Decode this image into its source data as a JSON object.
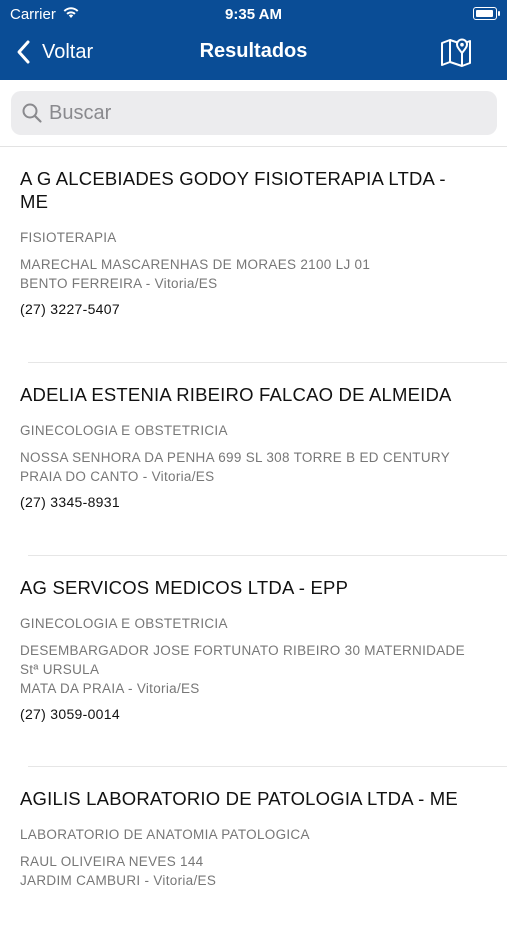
{
  "status_bar": {
    "carrier": "Carrier",
    "time": "9:35 AM"
  },
  "nav": {
    "back_label": "Voltar",
    "title": "Resultados",
    "map_icon": "map-pin-icon"
  },
  "search": {
    "placeholder": "Buscar",
    "value": ""
  },
  "colors": {
    "nav_background": "#0a4d96",
    "search_background": "#ececee"
  },
  "results": [
    {
      "name": "A G ALCEBIADES GODOY FISIOTERAPIA LTDA - ME",
      "category": "FISIOTERAPIA",
      "street": "MARECHAL MASCARENHAS DE MORAES 2100 LJ 01",
      "locality": "BENTO FERREIRA - Vitoria/ES",
      "phone": "(27) 3227-5407"
    },
    {
      "name": "ADELIA ESTENIA RIBEIRO FALCAO DE ALMEIDA",
      "category": "GINECOLOGIA E OBSTETRICIA",
      "street": "NOSSA SENHORA DA PENHA 699 SL 308 TORRE B ED CENTURY",
      "locality": "PRAIA DO CANTO - Vitoria/ES",
      "phone": "(27) 3345-8931"
    },
    {
      "name": "AG SERVICOS MEDICOS LTDA - EPP",
      "category": "GINECOLOGIA E OBSTETRICIA",
      "street": "DESEMBARGADOR JOSE FORTUNATO RIBEIRO 30 MATERNIDADE Stª URSULA",
      "locality": "MATA DA PRAIA - Vitoria/ES",
      "phone": "(27) 3059-0014"
    },
    {
      "name": "AGILIS LABORATORIO DE PATOLOGIA LTDA - ME",
      "category": "LABORATORIO DE ANATOMIA PATOLOGICA",
      "street": "RAUL OLIVEIRA NEVES 144",
      "locality": "JARDIM CAMBURI - Vitoria/ES",
      "phone": ""
    }
  ]
}
